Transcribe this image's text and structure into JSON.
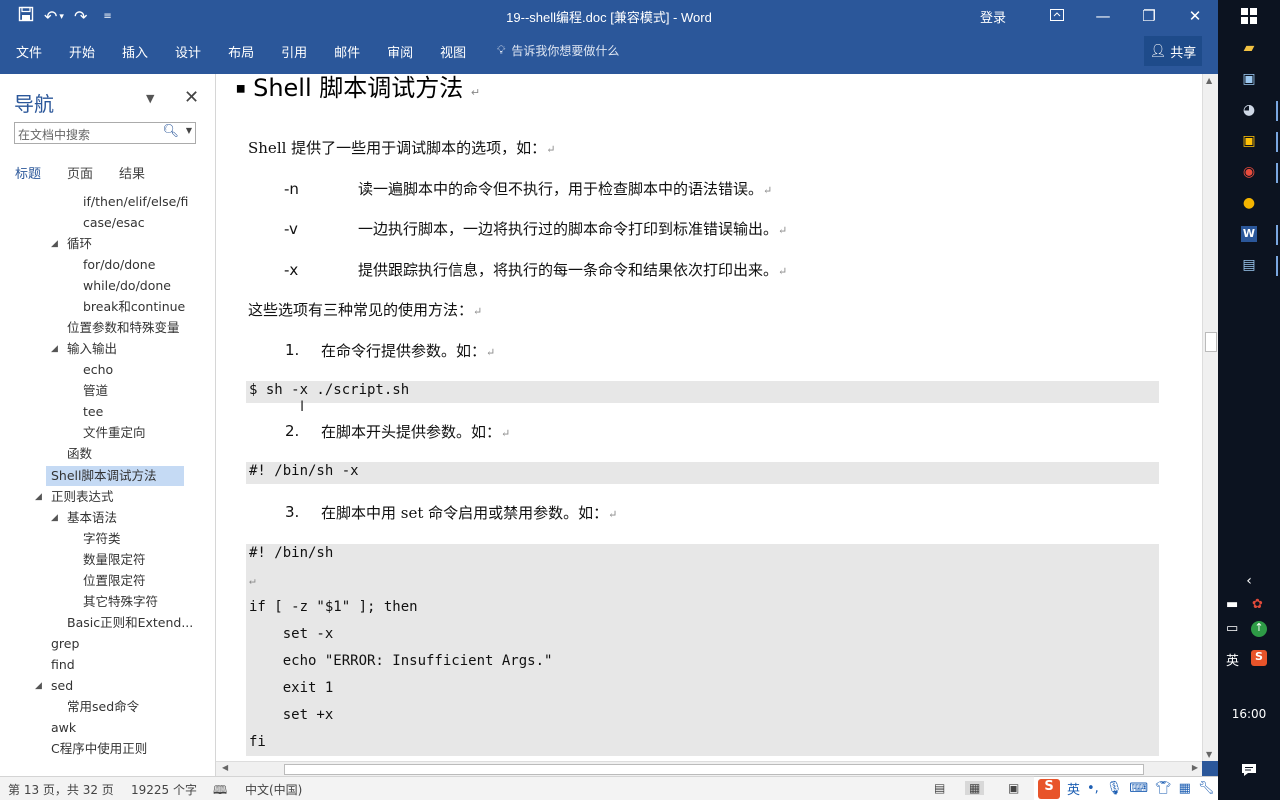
{
  "window": {
    "title": "19--shell编程.doc [兼容模式]  -  Word",
    "login": "登录",
    "share": "共享"
  },
  "quick_access": {
    "save_icon": "save-icon",
    "undo_icon": "undo-icon",
    "redo_icon": "redo-icon"
  },
  "ribbon": {
    "tabs": [
      "文件",
      "开始",
      "插入",
      "设计",
      "布局",
      "引用",
      "邮件",
      "审阅",
      "视图"
    ],
    "tell_me": "告诉我你想要做什么"
  },
  "nav": {
    "title": "导航",
    "search_placeholder": "在文档中搜索",
    "tabs": [
      "标题",
      "页面",
      "结果"
    ],
    "items": [
      {
        "label": "if/then/elif/else/fi"
      },
      {
        "label": "case/esac"
      },
      {
        "label": "循环"
      },
      {
        "label": "for/do/done"
      },
      {
        "label": "while/do/done"
      },
      {
        "label": "break和continue"
      },
      {
        "label": "位置参数和特殊变量"
      },
      {
        "label": "输入输出"
      },
      {
        "label": "echo"
      },
      {
        "label": "管道"
      },
      {
        "label": "tee"
      },
      {
        "label": "文件重定向"
      },
      {
        "label": "函数"
      },
      {
        "label": "Shell脚本调试方法"
      },
      {
        "label": "正则表达式"
      },
      {
        "label": "基本语法"
      },
      {
        "label": "字符类"
      },
      {
        "label": "数量限定符"
      },
      {
        "label": "位置限定符"
      },
      {
        "label": "其它特殊字符"
      },
      {
        "label": "Basic正则和Extend..."
      },
      {
        "label": "grep"
      },
      {
        "label": "find"
      },
      {
        "label": "sed"
      },
      {
        "label": "常用sed命令"
      },
      {
        "label": "awk"
      },
      {
        "label": "C程序中使用正则"
      }
    ]
  },
  "document": {
    "heading": "Shell 脚本调试方法",
    "intro": "Shell 提供了一些用于调试脚本的选项，如：",
    "options": [
      {
        "flag": "-n",
        "desc": "读一遍脚本中的命令但不执行，用于检查脚本中的语法错误。"
      },
      {
        "flag": "-v",
        "desc": "一边执行脚本，一边将执行过的脚本命令打印到标准错误输出。"
      },
      {
        "flag": "-x",
        "desc": "提供跟踪执行信息，将执行的每一条命令和结果依次打印出来。"
      }
    ],
    "usage_intro": "这些选项有三种常见的使用方法：",
    "steps": [
      {
        "num": "1.",
        "text": "在命令行提供参数。如："
      },
      {
        "num": "2.",
        "text": "在脚本开头提供参数。如："
      },
      {
        "num": "3.",
        "text": "在脚本中用 set 命令启用或禁用参数。如："
      }
    ],
    "code1": "$ sh -x ./script.sh",
    "code2": "#! /bin/sh -x",
    "code3": [
      "#! /bin/sh",
      "",
      "if [ -z \"$1\" ]; then",
      "    set -x",
      "    echo \"ERROR: Insufficient Args.\"",
      "    exit 1",
      "    set +x",
      "fi"
    ]
  },
  "status": {
    "page": "第 13 页，共 32 页",
    "words": "19225 个字",
    "language": "中文(中国)"
  },
  "taskbar": {
    "time": "16:00",
    "ime": "英"
  }
}
